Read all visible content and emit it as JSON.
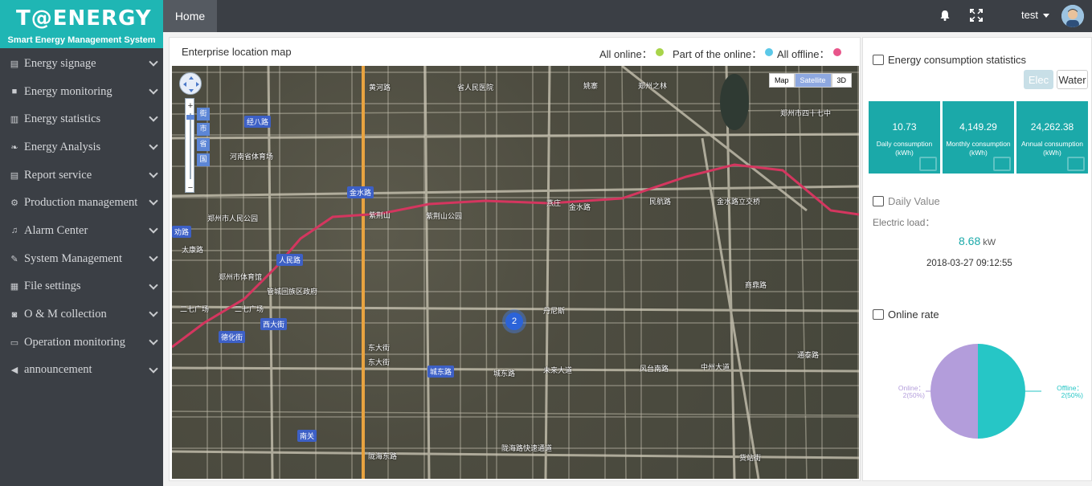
{
  "app": {
    "logo": "T@ENERGY",
    "subtitle": "Smart Energy Management System"
  },
  "sidebar": {
    "items": [
      {
        "label": "Energy signage",
        "icon": "signage-icon"
      },
      {
        "label": "Energy monitoring",
        "icon": "camera-icon"
      },
      {
        "label": "Energy statistics",
        "icon": "bar-chart-icon"
      },
      {
        "label": "Energy Analysis",
        "icon": "leaf-icon"
      },
      {
        "label": "Report service",
        "icon": "report-icon"
      },
      {
        "label": "Production management",
        "icon": "gear-icon"
      },
      {
        "label": "Alarm Center",
        "icon": "bell-icon"
      },
      {
        "label": "System Management",
        "icon": "wrench-icon"
      },
      {
        "label": "File settings",
        "icon": "file-icon"
      },
      {
        "label": "O & M collection",
        "icon": "camera-icon"
      },
      {
        "label": "Operation monitoring",
        "icon": "monitor-icon"
      },
      {
        "label": "announcement",
        "icon": "megaphone-icon"
      }
    ]
  },
  "topbar": {
    "home_tab": "Home",
    "user": "test"
  },
  "map": {
    "title": "Enterprise location map",
    "legend": {
      "all_online": "All online：",
      "part_online": "Part of the online：",
      "all_offline": "All offline："
    },
    "colors": {
      "all_online": "#a8d44a",
      "part_online": "#5bc8e8",
      "all_offline": "#e8558a"
    },
    "map_types": [
      "Map",
      "Satellite",
      "3D"
    ],
    "active_type": "Satellite",
    "zoom_buttons": [
      "街",
      "市",
      "省",
      "国"
    ],
    "cluster_count": "2",
    "road_tags": [
      "经八路",
      "金水路",
      "人民路",
      "西大街",
      "德化街",
      "城东路",
      "南关",
      "劝路"
    ],
    "labels": [
      "黄河路",
      "省人民医院",
      "姚寨",
      "郑州之林",
      "紫荆山",
      "燕庄",
      "金水路",
      "民航路",
      "金水路立交桥",
      "郑州市四十七中",
      "二七广场",
      "二七广场",
      "东大街",
      "东大街",
      "城东路",
      "未来大道",
      "中州大道",
      "陇海东路",
      "陇海路快速通道",
      "管城回族区政府",
      "河南省体育场",
      "郑州市体育馆",
      "太康路",
      "郑州市人民公园",
      "紫荆山公园",
      "货站街",
      "丹尼斯",
      "商鼎路",
      "风台南路",
      "通泰路"
    ]
  },
  "energy": {
    "title": "Energy consumption statistics",
    "toggle_elec": "Elec",
    "toggle_water": "Water",
    "stats": [
      {
        "value": "10.73",
        "label_line1": "Daily consumption",
        "label_line2": "(kWh)"
      },
      {
        "value": "4,149.29",
        "label_line1": "Monthly consumption",
        "label_line2": "(kWh)"
      },
      {
        "value": "24,262.38",
        "label_line1": "Annual consumption",
        "label_line2": "(kWh)"
      }
    ]
  },
  "daily": {
    "title": "Daily Value",
    "electric_load_label": "Electric load：",
    "value": "8.68",
    "unit": "kW",
    "timestamp": "2018-03-27 09:12:55"
  },
  "online_rate": {
    "title": "Online rate",
    "online_label": "Online：",
    "online_value": "2(50%)",
    "offline_label": "Offline：",
    "offline_value": "2(50%)",
    "online_color": "#b39ddb",
    "offline_color": "#26c6c6"
  },
  "chart_data": {
    "type": "pie",
    "title": "",
    "categories": [
      "Online",
      "Offline"
    ],
    "values": [
      2,
      2
    ],
    "colors": [
      "#b39ddb",
      "#26c6c6"
    ]
  }
}
